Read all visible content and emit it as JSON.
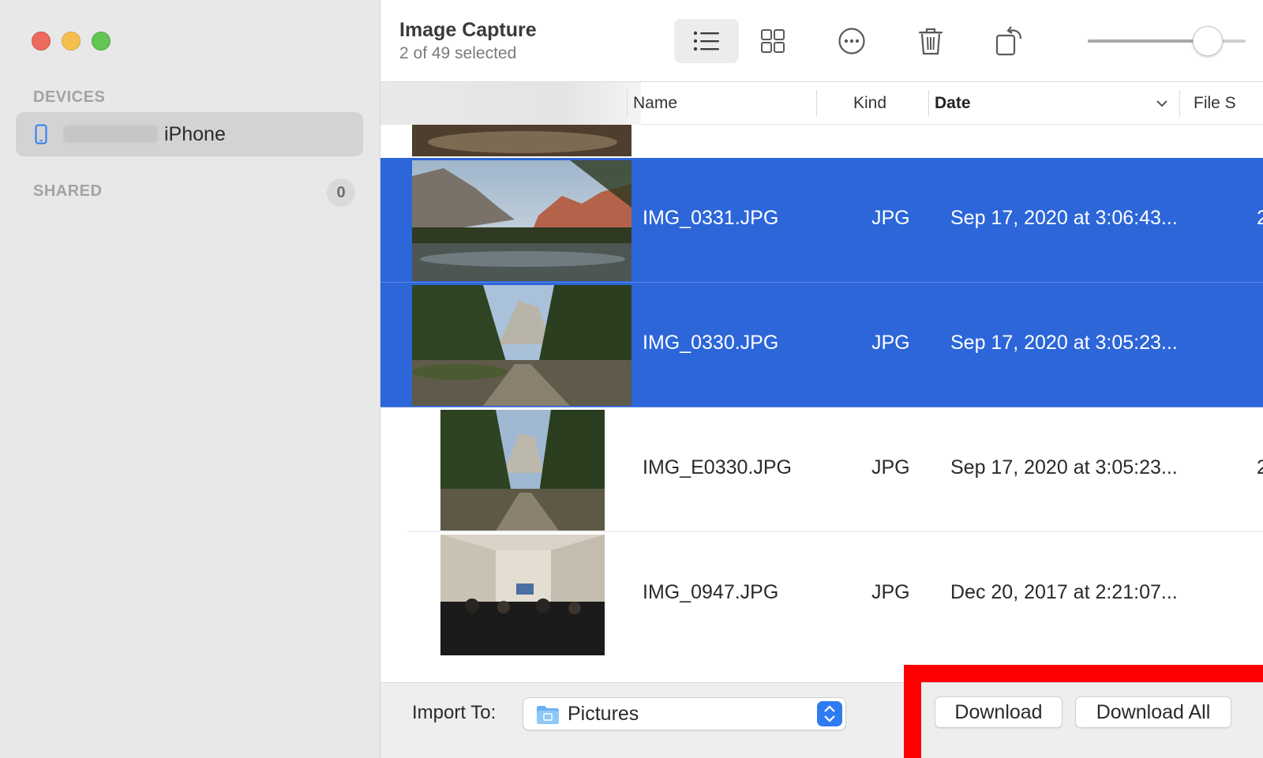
{
  "window": {
    "title": "Image Capture",
    "subtitle": "2 of 49 selected"
  },
  "sidebar": {
    "devices_heading": "DEVICES",
    "device_name": "iPhone",
    "shared_heading": "SHARED",
    "shared_count": "0"
  },
  "toolbar": {
    "view_mode": "list",
    "thumbnail_size_fraction": 0.82
  },
  "columns": {
    "name": "Name",
    "kind": "Kind",
    "date": "Date",
    "file_size": "File S"
  },
  "rows": [
    {
      "name": "IMG_0331.JPG",
      "kind": "JPG",
      "date": "Sep 17, 2020 at 3:06:43...",
      "size": "2",
      "selected": true
    },
    {
      "name": "IMG_0330.JPG",
      "kind": "JPG",
      "date": "Sep 17, 2020 at 3:05:23...",
      "size": "",
      "selected": true
    },
    {
      "name": "IMG_E0330.JPG",
      "kind": "JPG",
      "date": "Sep 17, 2020 at 3:05:23...",
      "size": "2",
      "selected": false
    },
    {
      "name": "IMG_0947.JPG",
      "kind": "JPG",
      "date": "Dec 20, 2017 at 2:21:07...",
      "size": "",
      "selected": false
    }
  ],
  "bottom": {
    "import_label": "Import To:",
    "import_destination": "Pictures",
    "download_label": "Download",
    "download_all_label": "Download All"
  },
  "colors": {
    "selection": "#2c66d9",
    "highlight_frame": "#ff0000",
    "accent": "#2f7bf2"
  }
}
